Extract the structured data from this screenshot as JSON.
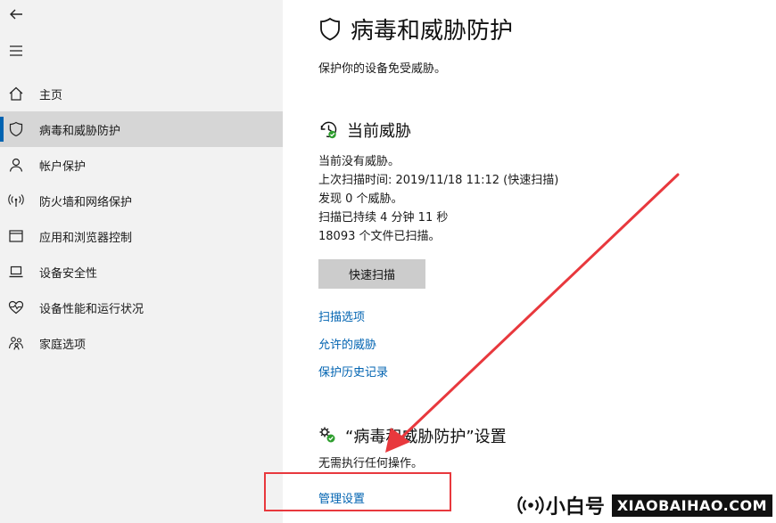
{
  "sidebar": {
    "items": [
      {
        "label": "主页",
        "icon": "home-icon",
        "active": false
      },
      {
        "label": "病毒和威胁防护",
        "icon": "shield-icon",
        "active": true
      },
      {
        "label": "帐户保护",
        "icon": "person-icon",
        "active": false
      },
      {
        "label": "防火墙和网络保护",
        "icon": "wireless-icon",
        "active": false
      },
      {
        "label": "应用和浏览器控制",
        "icon": "browser-window-icon",
        "active": false
      },
      {
        "label": "设备安全性",
        "icon": "laptop-icon",
        "active": false
      },
      {
        "label": "设备性能和运行状况",
        "icon": "heart-pulse-icon",
        "active": false
      },
      {
        "label": "家庭选项",
        "icon": "family-icon",
        "active": false
      }
    ]
  },
  "page": {
    "title": "病毒和威胁防护",
    "subtitle": "保护你的设备免受威胁。"
  },
  "current_threats": {
    "title": "当前威胁",
    "status": "当前没有威胁。",
    "last_scan": "上次扫描时间: 2019/11/18 11:12 (快速扫描)",
    "threats_found": "发现 0 个威胁。",
    "duration": "扫描已持续 4 分钟 11 秒",
    "files_scanned": "18093 个文件已扫描。",
    "quick_scan_label": "快速扫描",
    "links": {
      "scan_options": "扫描选项",
      "allowed_threats": "允许的威胁",
      "protection_history": "保护历史记录"
    }
  },
  "settings": {
    "title": "“病毒和威胁防护”设置",
    "description": "无需执行任何操作。",
    "manage_link": "管理设置"
  },
  "watermark": {
    "cn": "小白号",
    "domain": "XIAOBAIHAO.COM"
  },
  "colors": {
    "accent": "#0063b1",
    "annotation": "#e8383d",
    "sidebar_bg": "#f2f2f2",
    "active_bg": "#d6d6d6",
    "ok_green": "#2e9e2e"
  }
}
